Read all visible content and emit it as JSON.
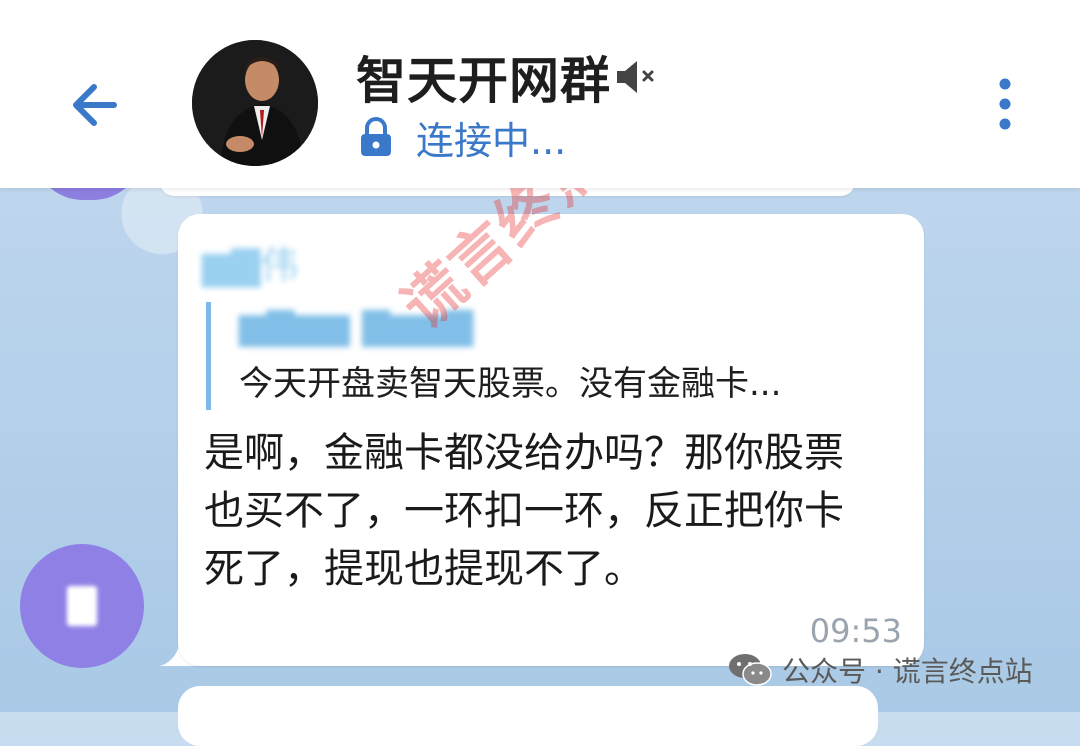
{
  "header": {
    "title": "智天开网群",
    "status": "连接中...",
    "icons": {
      "back": "arrow-left-icon",
      "mute": "muted-speaker-icon",
      "lock": "lock-icon",
      "menu": "more-vertical-icon"
    },
    "accent_color": "#3a78c9"
  },
  "message": {
    "quote": {
      "text": "今天开盘卖智天股票。没有金融卡..."
    },
    "text": "是啊，金融卡都没给办吗？那你股票也买不了，一环扣一环，反正把你卡死了，提现也提现不了。",
    "time": "09:53"
  },
  "watermark": "谎言终点站",
  "footer": {
    "account": "公众号 · 谎言终点站"
  }
}
